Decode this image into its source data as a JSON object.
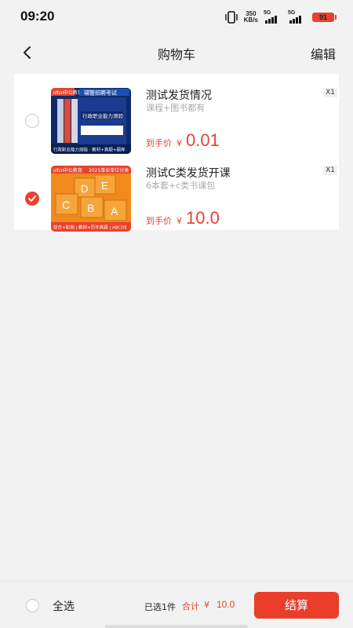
{
  "status": {
    "time": "09:20",
    "net_speed_value": "350",
    "net_speed_unit": "KB/s",
    "signal_1": "5G",
    "signal_2": "5G",
    "battery": "91"
  },
  "nav": {
    "back_icon": "chevron-left-icon",
    "title": "购物车",
    "edit": "编辑"
  },
  "cart": {
    "items": [
      {
        "title": "测试发货情况",
        "subtitle": "课程+图书都有",
        "qty": "X1",
        "price_label": "到手价",
        "currency": "¥",
        "price": "0.01",
        "selected": false,
        "thumb": {
          "brand": "offcn中公教育",
          "banner": "辅警招聘考试",
          "book_title": "行政职业能力测验",
          "footer": "行政职业能力测验 · 教材+真题+题库"
        }
      },
      {
        "title": "测试C类发货开课",
        "subtitle": "6本套+c类书课包",
        "qty": "X1",
        "price_label": "到手价",
        "currency": "¥",
        "price": "10.0",
        "selected": true,
        "thumb": {
          "brand": "offcn中公教育",
          "banner": "2025事业单位分类",
          "letters": [
            "E",
            "D",
            "C",
            "B",
            "A"
          ],
          "footer": "综合+职测 | 教材+历年真题 | ABCDE"
        }
      }
    ]
  },
  "footer": {
    "select_all": "全选",
    "selected_count": "已选1件",
    "total_label": "合计",
    "total_currency": "¥",
    "total_value": "10.0",
    "checkout": "结算"
  },
  "colors": {
    "accent": "#e8432e",
    "background": "#f2f2f2"
  }
}
